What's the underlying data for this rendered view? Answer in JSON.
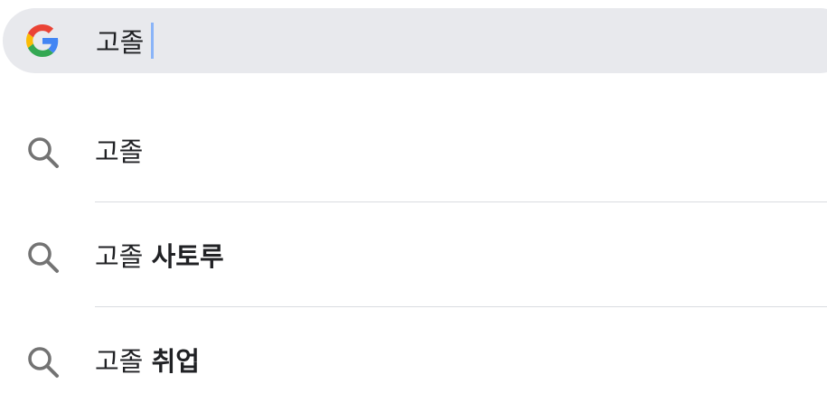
{
  "search": {
    "query": "고졸",
    "cursor_color": "#8ab4f8",
    "bar_color": "#e8e9ed"
  },
  "icons": {
    "logo": "google-g-icon",
    "suggestion": "search-icon"
  },
  "suggestions": [
    {
      "prefix": "고졸",
      "completion": ""
    },
    {
      "prefix": "고졸",
      "completion": "사토루"
    },
    {
      "prefix": "고졸",
      "completion": "취업"
    }
  ]
}
